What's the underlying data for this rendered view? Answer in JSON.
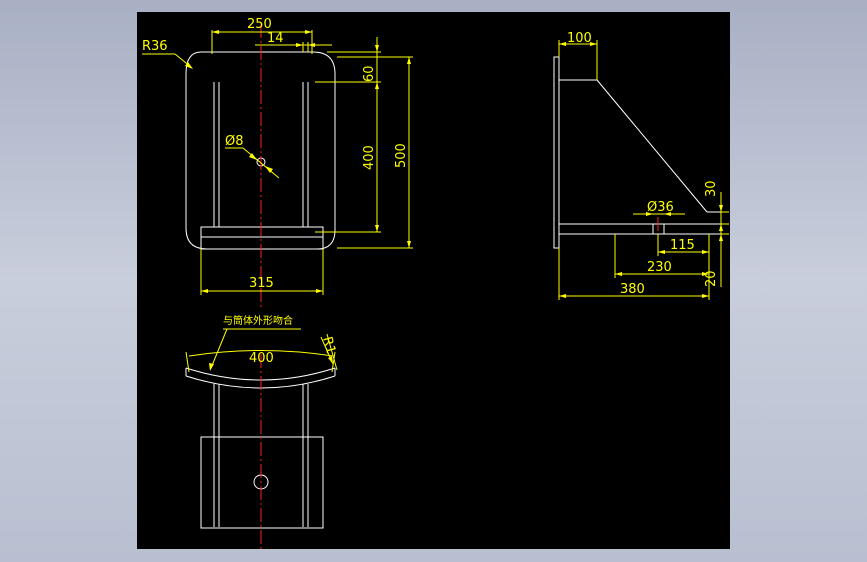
{
  "drawing": {
    "front_view": {
      "dim_width_top": "250",
      "dim_offset": "14",
      "dim_radius": "R36",
      "dim_height_60": "60",
      "dim_height_400": "400",
      "dim_height_500": "500",
      "dim_hole": "Ø8",
      "dim_width_bottom": "315"
    },
    "side_view": {
      "dim_top": "100",
      "dim_hole": "Ø36",
      "dim_30": "30",
      "dim_115": "115",
      "dim_230": "230",
      "dim_20": "20",
      "dim_380": "380"
    },
    "plan_view": {
      "note": "与筒体外形吻合",
      "dim_arc": "400",
      "dim_r": "R1"
    }
  },
  "colors": {
    "background": "#000000",
    "geometry": "#ffffff",
    "dimension": "#ffff00",
    "centerline": "#ff2020",
    "window": "#b8bfd0"
  }
}
